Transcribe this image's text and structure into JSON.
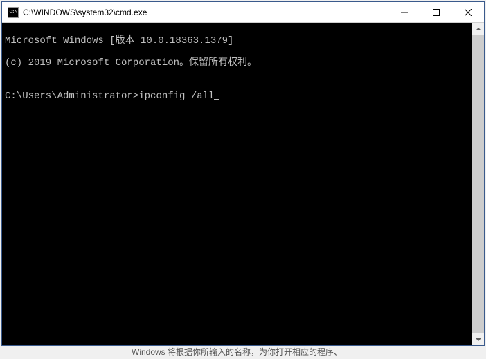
{
  "titlebar": {
    "icon_text": "C:\\",
    "title": "C:\\WINDOWS\\system32\\cmd.exe"
  },
  "console": {
    "line1": "Microsoft Windows [版本 10.0.18363.1379]",
    "line2": "(c) 2019 Microsoft Corporation。保留所有权利。",
    "blank": "",
    "prompt": "C:\\Users\\Administrator>",
    "command": "ipconfig /all"
  },
  "background": {
    "hint_text": "Windows 将根据你所输入的名称，为你打开相应的程序、"
  }
}
